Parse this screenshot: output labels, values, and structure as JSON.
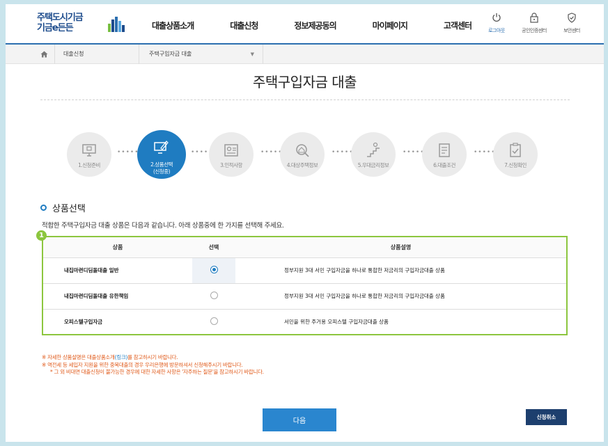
{
  "header": {
    "logo_line1": "주택도시기금",
    "logo_line2": "기금e든든",
    "nav": [
      "대출상품소개",
      "대출신청",
      "정보제공동의",
      "마이페이지",
      "고객센터"
    ],
    "util": [
      {
        "label": "로그아웃",
        "icon": "power-icon",
        "active": true
      },
      {
        "label": "공인인증센터",
        "icon": "lock-icon",
        "active": false
      },
      {
        "label": "보안센터",
        "icon": "shield-icon",
        "active": false
      }
    ],
    "brand_color": "#1c4b8c",
    "accent_color": "#2b6fb0"
  },
  "breadcrumb": {
    "home_icon": "home-icon",
    "level1": "대출신청",
    "level2": "주택구입자금 대출"
  },
  "page_title": "주택구입자금 대출",
  "steps": [
    {
      "label": "1.신청준비",
      "icon": "monitor-icon"
    },
    {
      "label": "2.상품선택",
      "sub": "(신청중)",
      "icon": "pen-screen-icon",
      "active": true
    },
    {
      "label": "3.인적사항",
      "icon": "id-card-icon"
    },
    {
      "label": "4.대상주택정보",
      "icon": "house-search-icon"
    },
    {
      "label": "5.우대금리정보",
      "icon": "stairs-coin-icon"
    },
    {
      "label": "6.대출조건",
      "icon": "document-icon"
    },
    {
      "label": "7.신청확인",
      "icon": "checklist-icon"
    }
  ],
  "section": {
    "title": "상품선택",
    "description": "적합한 주택구입자금 대출 상품은 다음과 같습니다. 아래 상품중에 한 가지를 선택해 주세요.",
    "marker": "1"
  },
  "table": {
    "headers": [
      "상품",
      "선택",
      "상품설명"
    ],
    "rows": [
      {
        "name": "내집마련디딤돌대출 일반",
        "selected": true,
        "desc": "정부지원 3대 서민 구입자금을 하나로 통합한 저금리의 구입자금대출 상품"
      },
      {
        "name": "내집마련디딤돌대출 유한책임",
        "selected": false,
        "desc": "정부지원 3대 서민 구입자금을 하나로 통합한 저금리의 구입자금대출 상품"
      },
      {
        "name": "오피스텔구입자금",
        "selected": false,
        "desc": "서민을 위한 주거용 오피스텔 구입자금대출 상품"
      }
    ],
    "border_color": "#8cc63e"
  },
  "notes": {
    "note1_pre": "※ 자세한 상품설명은 대출상품소개",
    "note1_link": "(링크)",
    "note1_post": "를 참고하시기 바랍니다.",
    "note2": "※ 역전세 등 세입자 지원을 위한 중복대출의 경우 우리은행에 방문하셔서 신청해주시기 바랍니다.",
    "note3": "* 그 외 비대면 대출신청이 불가능한 경우에 대한 자세한 사항은 '자주하는 질문'을 참고하시기 바랍니다.",
    "color": "#e05a1a"
  },
  "buttons": {
    "next": "다음",
    "cancel": "신청취소"
  }
}
